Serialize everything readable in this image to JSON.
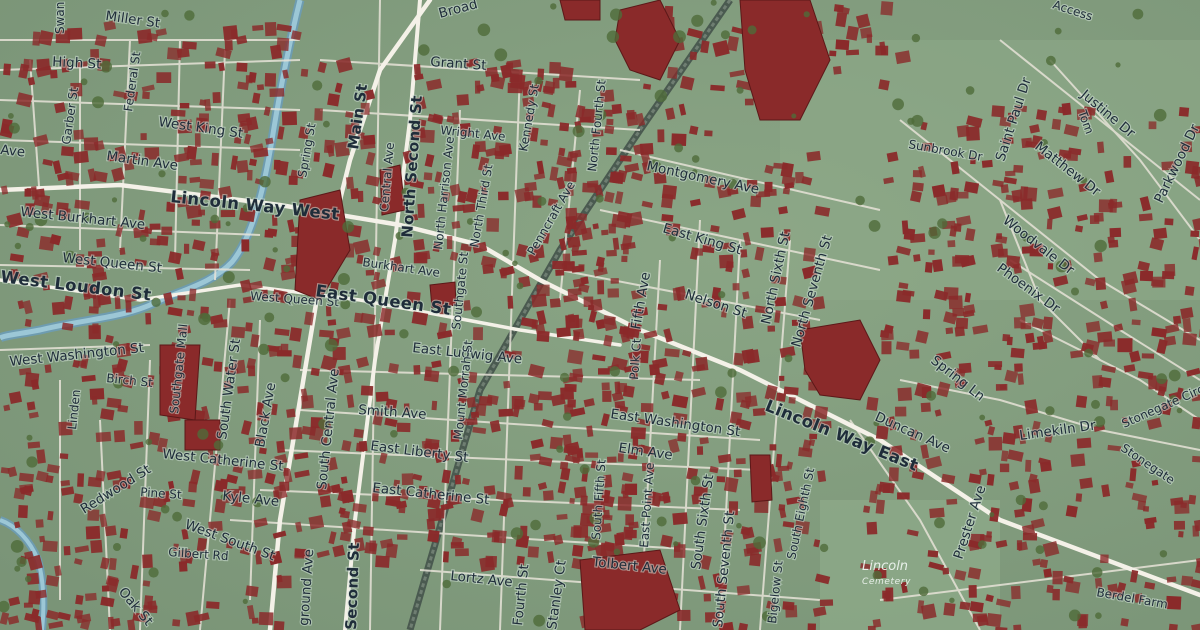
{
  "colors": {
    "land": "#7f9a7c",
    "land_light": "#93ad8f",
    "building": "#8a2a2a",
    "road": "#f2efe6",
    "water": "#8fb9c9",
    "rail": "#5a6a5f",
    "tree": "#4f6b3a"
  },
  "streets": [
    {
      "id": "miller-st",
      "name": "Miller St",
      "size": "md"
    },
    {
      "id": "grant-st",
      "name": "Grant St",
      "size": "md"
    },
    {
      "id": "high-st",
      "name": "High St",
      "size": "md"
    },
    {
      "id": "broad",
      "name": "Broad",
      "size": "md"
    },
    {
      "id": "west-king-st",
      "name": "West King St",
      "size": "md"
    },
    {
      "id": "martin-ave",
      "name": "Martin Ave",
      "size": "md"
    },
    {
      "id": "ave-left",
      "name": "Ave",
      "size": "md"
    },
    {
      "id": "swan",
      "name": "Swan",
      "size": "sm"
    },
    {
      "id": "garber-st",
      "name": "Garber St",
      "size": "sm"
    },
    {
      "id": "federal-st",
      "name": "Federal St",
      "size": "sm"
    },
    {
      "id": "main-st",
      "name": "Main St",
      "size": "lg"
    },
    {
      "id": "north-second-st",
      "name": "North Second St",
      "size": "lg"
    },
    {
      "id": "wright-ave",
      "name": "Wright Ave",
      "size": "sm"
    },
    {
      "id": "kennedy-st",
      "name": "Kennedy St",
      "size": "sm"
    },
    {
      "id": "north-fourth-st",
      "name": "North Fourth St",
      "size": "sm"
    },
    {
      "id": "spring-st",
      "name": "Spring St",
      "size": "sm"
    },
    {
      "id": "lincoln-way-west",
      "name": "Lincoln Way West",
      "size": "xl"
    },
    {
      "id": "west-burkhart-ave",
      "name": "West Burkhart Ave",
      "size": "md"
    },
    {
      "id": "west-queen-st",
      "name": "West Queen St",
      "size": "md"
    },
    {
      "id": "west-loudon-st",
      "name": "West Loudon St",
      "size": "xl"
    },
    {
      "id": "central-ave",
      "name": "Central Ave",
      "size": "sm"
    },
    {
      "id": "north-harrison-ave",
      "name": "North Harrison Ave",
      "size": "sm"
    },
    {
      "id": "north-third-st",
      "name": "North Third St",
      "size": "sm"
    },
    {
      "id": "burkhart-ave",
      "name": "Burkhart Ave",
      "size": "sm"
    },
    {
      "id": "west-queen-st-2",
      "name": "West Queen St",
      "size": "sm"
    },
    {
      "id": "east-queen-st",
      "name": "East Queen St",
      "size": "xl"
    },
    {
      "id": "southgate-st",
      "name": "Southgate St",
      "size": "sm"
    },
    {
      "id": "pennycraft-ave",
      "name": "Penncraft Ave",
      "size": "sm"
    },
    {
      "id": "montgomery-ave",
      "name": "Montgomery Ave",
      "size": "md"
    },
    {
      "id": "east-king-st",
      "name": "East King St",
      "size": "md"
    },
    {
      "id": "nelson-st",
      "name": "Nelson St",
      "size": "md"
    },
    {
      "id": "fifth-ave",
      "name": "Fifth Ave",
      "size": "md"
    },
    {
      "id": "north-sixth-st",
      "name": "North Sixth St",
      "size": "md"
    },
    {
      "id": "north-seventh-st",
      "name": "North Seventh St",
      "size": "md"
    },
    {
      "id": "sunbrook-dr",
      "name": "Sunbrook Dr",
      "size": "sm"
    },
    {
      "id": "saint-paul-dr",
      "name": "Saint Paul Dr",
      "size": "md"
    },
    {
      "id": "matthew-dr",
      "name": "Matthew Dr",
      "size": "md"
    },
    {
      "id": "justine-dr",
      "name": "Justine Dr",
      "size": "md"
    },
    {
      "id": "parkwood-dr",
      "name": "Parkwood Dr",
      "size": "md"
    },
    {
      "id": "woodvale-dr",
      "name": "Woodvale Dr",
      "size": "md"
    },
    {
      "id": "phoenix-dr",
      "name": "Phoenix Dr",
      "size": "md"
    },
    {
      "id": "access",
      "name": "Access",
      "size": "sm"
    },
    {
      "id": "west-washington-st",
      "name": "West Washington St",
      "size": "md"
    },
    {
      "id": "birch-st",
      "name": "Birch St",
      "size": "sm"
    },
    {
      "id": "linden",
      "name": "Linden",
      "size": "sm"
    },
    {
      "id": "southgate-mall",
      "name": "Southgate Mall",
      "size": "sm"
    },
    {
      "id": "south-water-st",
      "name": "South Water St",
      "size": "md"
    },
    {
      "id": "black-ave",
      "name": "Black Ave",
      "size": "md"
    },
    {
      "id": "south-central-ave",
      "name": "South Central Ave",
      "size": "md"
    },
    {
      "id": "east-ludwig-ave",
      "name": "East Ludwig Ave",
      "size": "md"
    },
    {
      "id": "polk-ct",
      "name": "Polk Ct",
      "size": "sm"
    },
    {
      "id": "lincoln-way-east",
      "name": "Lincoln Way East",
      "size": "xl"
    },
    {
      "id": "spring-ln",
      "name": "Spring Ln",
      "size": "md"
    },
    {
      "id": "duncan-ave",
      "name": "Duncan Ave",
      "size": "md"
    },
    {
      "id": "limekiln-dr",
      "name": "Limekiln Dr",
      "size": "md"
    },
    {
      "id": "stonegate-circle-north",
      "name": "Stonegate Circle North",
      "size": "sm"
    },
    {
      "id": "stonegate",
      "name": "Stonegate",
      "size": "sm"
    },
    {
      "id": "smith-ave",
      "name": "Smith Ave",
      "size": "md"
    },
    {
      "id": "mount-morrah-st",
      "name": "Mount Morrah St",
      "size": "sm"
    },
    {
      "id": "east-washington-st",
      "name": "East Washington St",
      "size": "md"
    },
    {
      "id": "east-liberty-st",
      "name": "East Liberty St",
      "size": "md"
    },
    {
      "id": "elm-ave",
      "name": "Elm Ave",
      "size": "md"
    },
    {
      "id": "redwood-st",
      "name": "Redwood St",
      "size": "md"
    },
    {
      "id": "west-catherine-st",
      "name": "West Catherine St",
      "size": "md"
    },
    {
      "id": "east-catherine-st",
      "name": "East Catherine St",
      "size": "md"
    },
    {
      "id": "kyle-ave",
      "name": "Kyle Ave",
      "size": "md"
    },
    {
      "id": "pine-st",
      "name": "Pine St",
      "size": "sm"
    },
    {
      "id": "west-south-st",
      "name": "West South St",
      "size": "md"
    },
    {
      "id": "south-fifth-st",
      "name": "South Fifth St",
      "size": "sm"
    },
    {
      "id": "east-point-ave",
      "name": "East Point Ave",
      "size": "sm"
    },
    {
      "id": "south-sixth-st",
      "name": "South Sixth St",
      "size": "md"
    },
    {
      "id": "south-eighth-st",
      "name": "South Eighth St",
      "size": "sm"
    },
    {
      "id": "prester-ave",
      "name": "Prester Ave",
      "size": "md"
    },
    {
      "id": "gilbert-rd",
      "name": "Gilbert Rd",
      "size": "sm"
    },
    {
      "id": "oak-st",
      "name": "Oak St",
      "size": "md"
    },
    {
      "id": "second-st-bottom",
      "name": "Second St",
      "size": "lg"
    },
    {
      "id": "ground-ave",
      "name": "ground Ave",
      "size": "md"
    },
    {
      "id": "lortz-ave",
      "name": "Lortz Ave",
      "size": "md"
    },
    {
      "id": "fourth-st-bottom",
      "name": "Fourth St",
      "size": "md"
    },
    {
      "id": "stanley-ct",
      "name": "Stanley Ct",
      "size": "md"
    },
    {
      "id": "tolbert-ave",
      "name": "Tolbert Ave",
      "size": "md"
    },
    {
      "id": "south-seventh-st",
      "name": "South Seventh St",
      "size": "md"
    },
    {
      "id": "bigelow-st",
      "name": "Bigelow St",
      "size": "sm"
    },
    {
      "id": "berdel-farm",
      "name": "Berdel Farm",
      "size": "sm"
    },
    {
      "id": "tom",
      "name": "Tom",
      "size": "sm"
    }
  ],
  "areas": [
    {
      "id": "lincoln-cemetery",
      "name": "Lincoln",
      "sub": "Cemetery"
    }
  ]
}
